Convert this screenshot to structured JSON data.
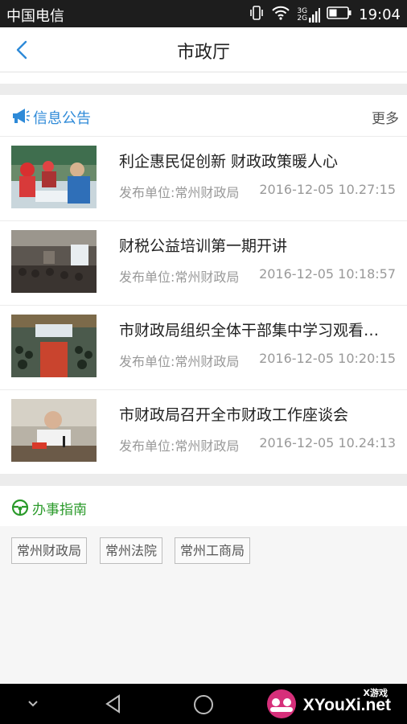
{
  "status_bar": {
    "carrier": "中国电信",
    "network": "3G",
    "network2": "2G",
    "time": "19:04"
  },
  "header": {
    "title": "市政厅"
  },
  "notice": {
    "title": "信息公告",
    "more": "更多",
    "items": [
      {
        "headline": "利企惠民促创新 财政政策暖人心",
        "publisher": "发布单位:常州财政局",
        "time": "2016-12-05 10.27:15"
      },
      {
        "headline": "财税公益培训第一期开讲",
        "publisher": "发布单位:常州财政局",
        "time": "2016-12-05 10:18:57"
      },
      {
        "headline": "市财政局组织全体干部集中学习观看…",
        "publisher": "发布单位:常州财政局",
        "time": "2016-12-05 10:20:15"
      },
      {
        "headline": "市财政局召开全市财政工作座谈会",
        "publisher": "发布单位:常州财政局",
        "time": "2016-12-05 10.24:13"
      }
    ]
  },
  "guide": {
    "title": "办事指南",
    "tags": [
      "常州财政局",
      "常州法院",
      "常州工商局"
    ]
  },
  "watermark": {
    "tag": "X游戏",
    "brand": "XYouXi.net"
  },
  "colors": {
    "accent": "#2e8ad8",
    "guide": "#2a9a2a",
    "status_bar": "#1d1d1d"
  }
}
